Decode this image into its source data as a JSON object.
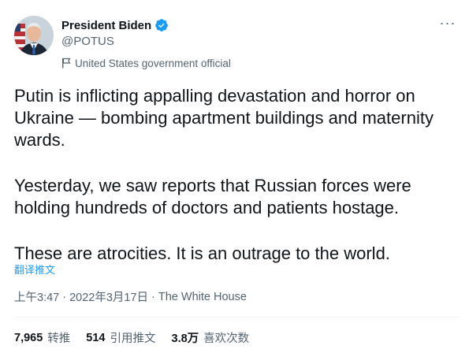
{
  "author": {
    "display_name": "President Biden",
    "handle": "@POTUS",
    "label": "United States government official"
  },
  "icons": {
    "verified": "verified-badge-icon",
    "label": "government-flag-icon",
    "more": "more-options-icon",
    "avatar": "profile-photo"
  },
  "colors": {
    "accent": "#1d9bf0",
    "text": "#0f1419",
    "muted": "#536471"
  },
  "more_label": "···",
  "tweet": {
    "paragraphs": [
      "Putin is inflicting appalling devastation and horror on Ukraine — bombing apartment buildings and maternity wards.",
      "Yesterday, we saw reports that Russian forces were holding hundreds of doctors and patients hostage.",
      "These are atrocities. It is an outrage to the world."
    ],
    "translate": "翻译推文"
  },
  "meta": {
    "time": "上午3:47",
    "date": "2022年3月17日",
    "source": "The White House",
    "separator": "·"
  },
  "stats": [
    {
      "value": "7,965",
      "label": "转推"
    },
    {
      "value": "514",
      "label": "引用推文"
    },
    {
      "value": "3.8万",
      "label": "喜欢次数"
    }
  ]
}
